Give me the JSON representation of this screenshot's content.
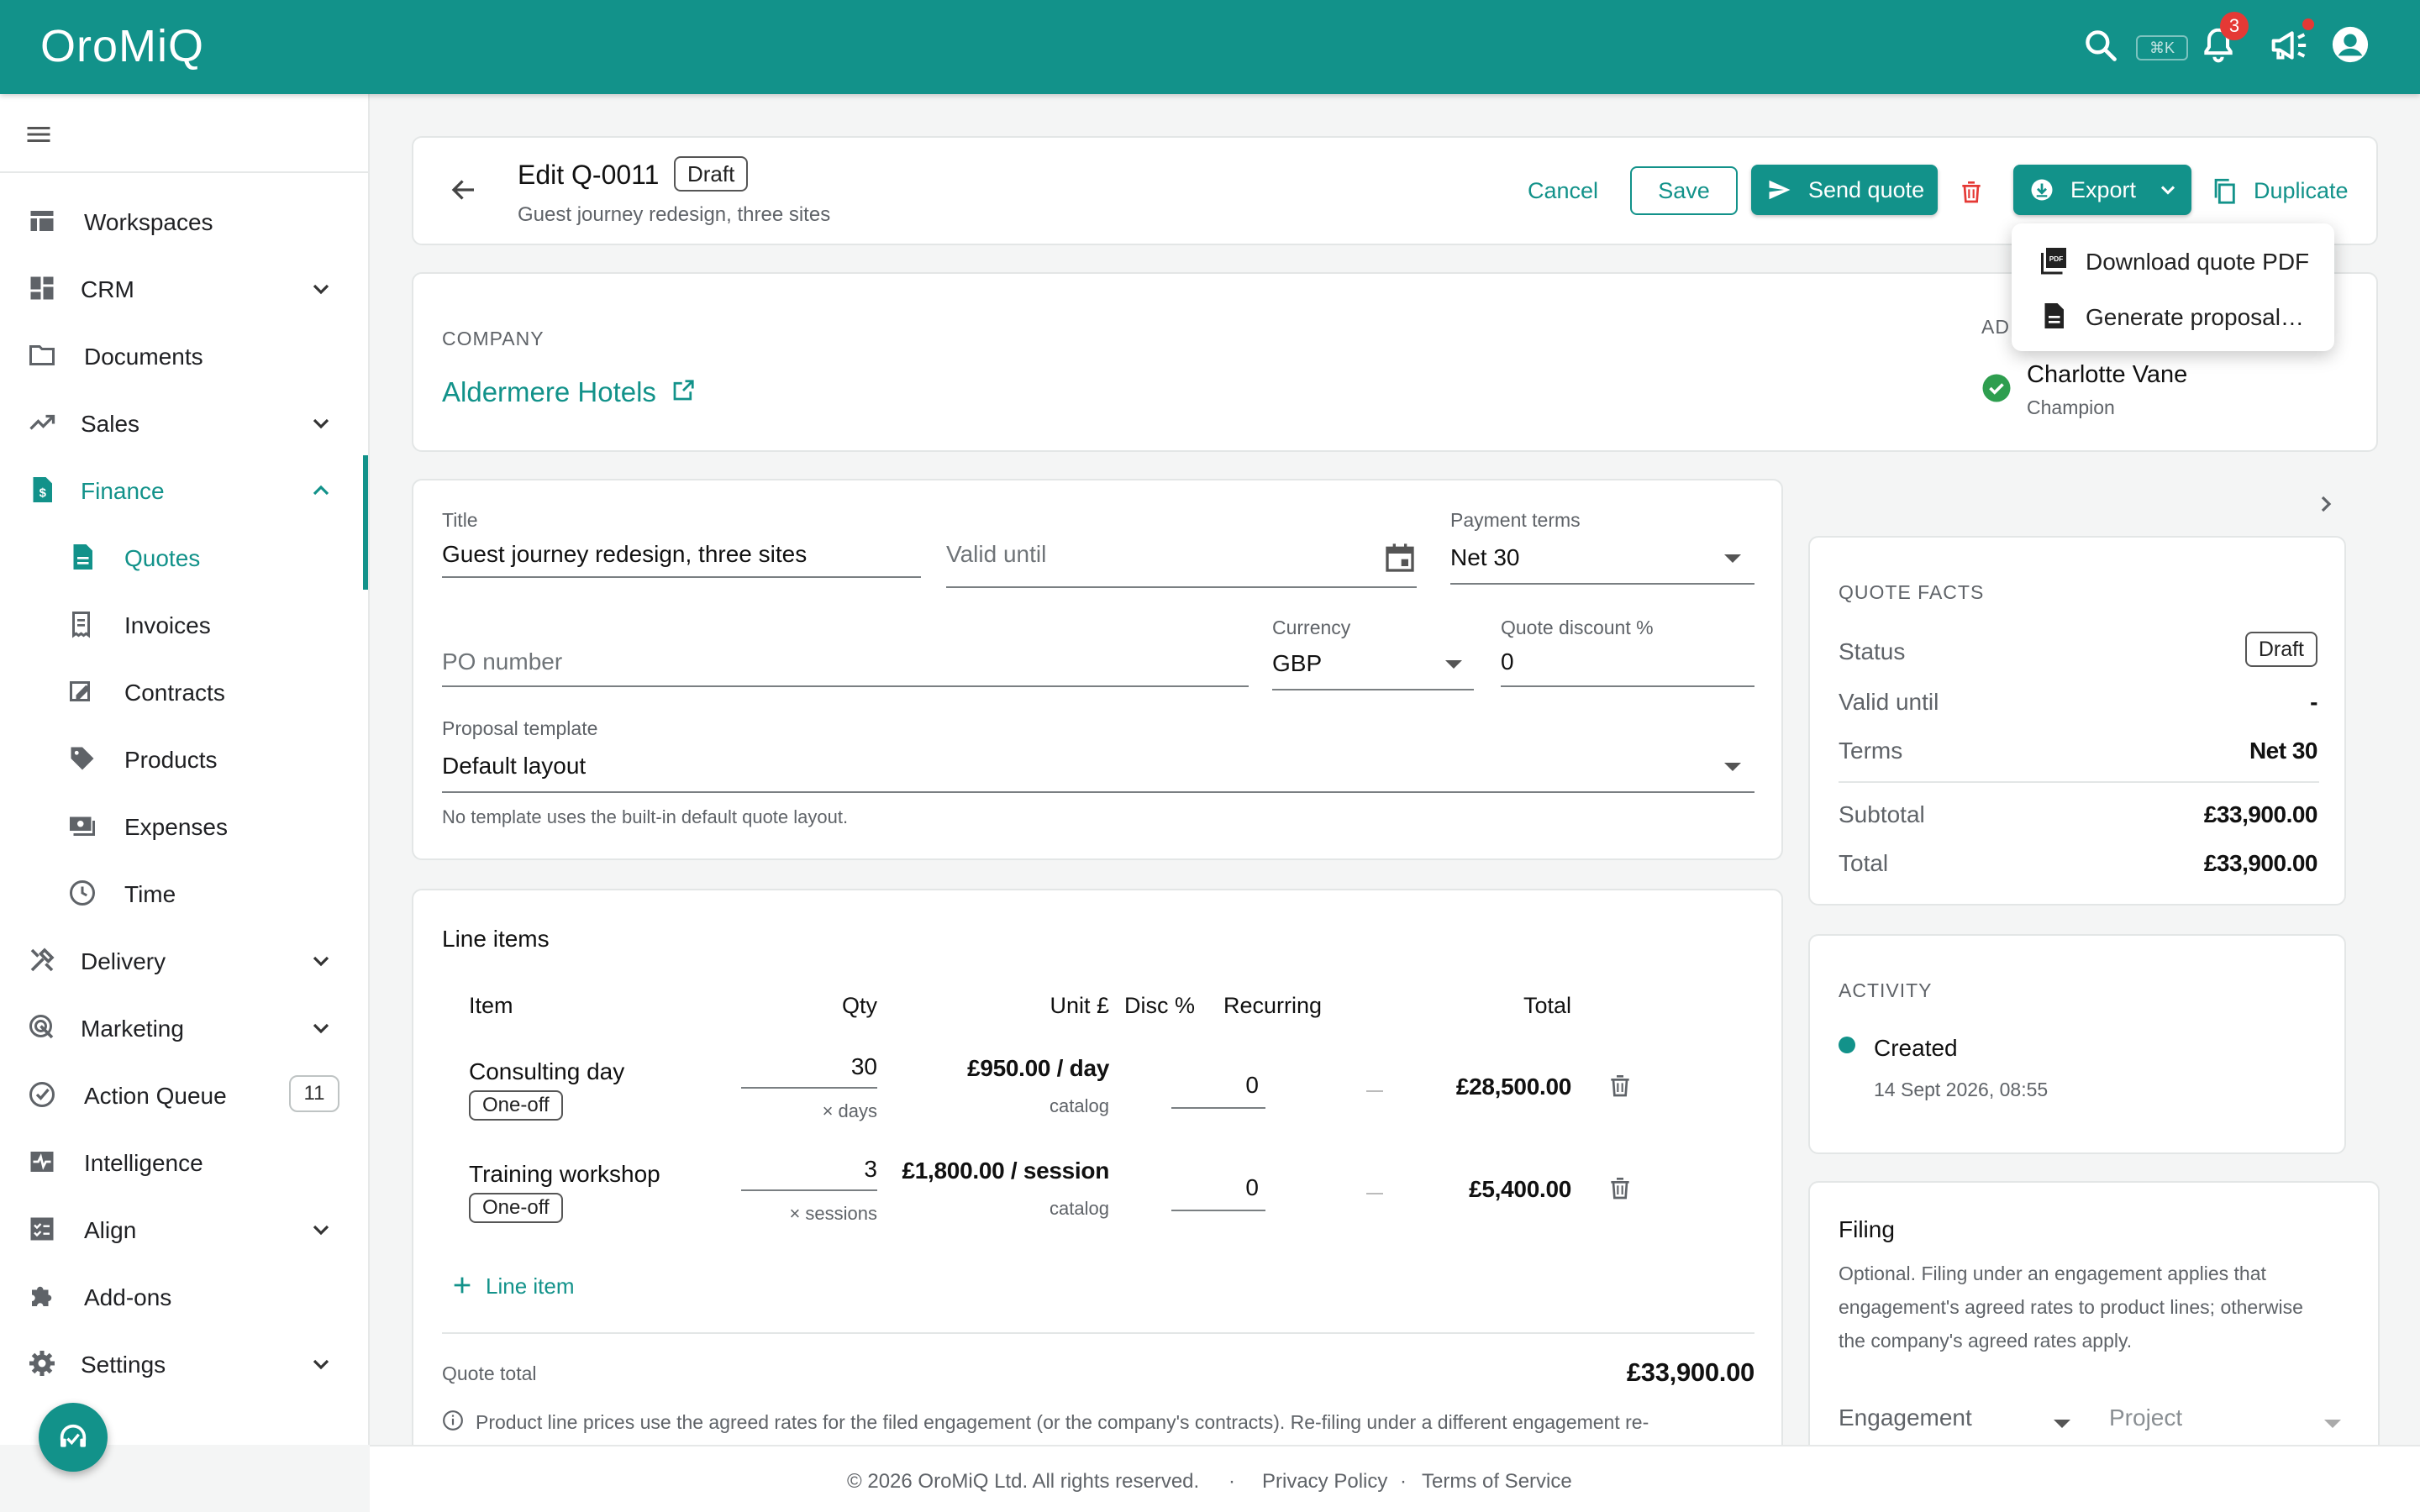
{
  "app": {
    "logo": "OroMiQ"
  },
  "topbar": {
    "shortcut": "⌘K",
    "notification_count": "3",
    "icons": [
      "search-icon",
      "notifications-icon",
      "announcements-icon",
      "account-icon"
    ],
    "brand_color": "#12928a"
  },
  "sidebar": {
    "items": [
      {
        "label": "Workspaces",
        "icon": "dashboard-icon"
      },
      {
        "label": "CRM",
        "icon": "grid-icon"
      },
      {
        "label": "Documents",
        "icon": "folder-icon"
      },
      {
        "label": "Sales",
        "icon": "trending-up-icon"
      },
      {
        "label": "Finance",
        "icon": "finance-doc-icon"
      },
      {
        "label": "Quotes",
        "icon": "quote-doc-icon"
      },
      {
        "label": "Invoices",
        "icon": "receipt-icon"
      },
      {
        "label": "Contracts",
        "icon": "contract-icon"
      },
      {
        "label": "Products",
        "icon": "tag-icon"
      },
      {
        "label": "Expenses",
        "icon": "payments-icon"
      },
      {
        "label": "Time",
        "icon": "clock-icon"
      },
      {
        "label": "Delivery",
        "icon": "tools-icon"
      },
      {
        "label": "Marketing",
        "icon": "target-icon"
      },
      {
        "label": "Action Queue",
        "icon": "check-circle-icon",
        "badge": "11"
      },
      {
        "label": "Intelligence",
        "icon": "pulse-icon"
      },
      {
        "label": "Align",
        "icon": "checklist-icon"
      },
      {
        "label": "Add-ons",
        "icon": "puzzle-icon"
      },
      {
        "label": "Settings",
        "icon": "gear-icon"
      }
    ]
  },
  "header": {
    "title": "Edit Q-0011",
    "status": "Draft",
    "subtitle": "Guest journey redesign, three sites",
    "cancel": "Cancel",
    "save": "Save",
    "send": "Send quote",
    "export": "Export",
    "duplicate": "Duplicate"
  },
  "export_menu": {
    "items": [
      {
        "label": "Download quote PDF",
        "icon": "pdf-icon"
      },
      {
        "label": "Generate proposal…",
        "icon": "document-icon"
      }
    ]
  },
  "company": {
    "label": "COMPANY",
    "name": "Aldermere Hotels",
    "contact_label_partial": "AD",
    "contact_name": "Charlotte Vane",
    "contact_role": "Champion"
  },
  "form": {
    "title_label": "Title",
    "title_value": "Guest journey redesign, three sites",
    "valid_until_placeholder": "Valid until",
    "payment_terms_label": "Payment terms",
    "payment_terms_value": "Net 30",
    "po_placeholder": "PO number",
    "currency_label": "Currency",
    "currency_value": "GBP",
    "discount_label": "Quote discount %",
    "discount_value": "0",
    "template_label": "Proposal template",
    "template_value": "Default layout",
    "template_helper": "No template uses the built-in default quote layout."
  },
  "line_items": {
    "title": "Line items",
    "columns": [
      "Item",
      "Qty",
      "Unit £",
      "Disc %",
      "Recurring",
      "Total"
    ],
    "rows": [
      {
        "item": "Consulting day",
        "type": "One-off",
        "qty": "30",
        "qty_unit": "× days",
        "unit": "£950.00 / day",
        "unit_source": "catalog",
        "disc": "0",
        "total": "£28,500.00"
      },
      {
        "item": "Training workshop",
        "type": "One-off",
        "qty": "3",
        "qty_unit": "× sessions",
        "unit": "£1,800.00 / session",
        "unit_source": "catalog",
        "disc": "0",
        "total": "£5,400.00"
      }
    ],
    "add_label": "Line item",
    "quote_total_label": "Quote total",
    "quote_total": "£33,900.00",
    "note": "Product line prices use the agreed rates for the filed engagement (or the company's contracts). Re-filing under a different engagement re-"
  },
  "quote_facts": {
    "title": "QUOTE FACTS",
    "status_label": "Status",
    "status": "Draft",
    "valid_until_label": "Valid until",
    "valid_until": "-",
    "terms_label": "Terms",
    "terms": "Net 30",
    "subtotal_label": "Subtotal",
    "subtotal": "£33,900.00",
    "total_label": "Total",
    "total": "£33,900.00"
  },
  "activity": {
    "title": "ACTIVITY",
    "event": "Created",
    "time": "14 Sept 2026, 08:55"
  },
  "filing": {
    "title": "Filing",
    "desc": "Optional. Filing under an engagement applies that engagement's agreed rates to product lines; otherwise the company's agreed rates apply.",
    "engagement": "Engagement",
    "project": "Project"
  },
  "footer": {
    "copyright": "© 2026 OroMiQ Ltd. All rights reserved.",
    "privacy": "Privacy Policy",
    "terms": "Terms of Service"
  }
}
